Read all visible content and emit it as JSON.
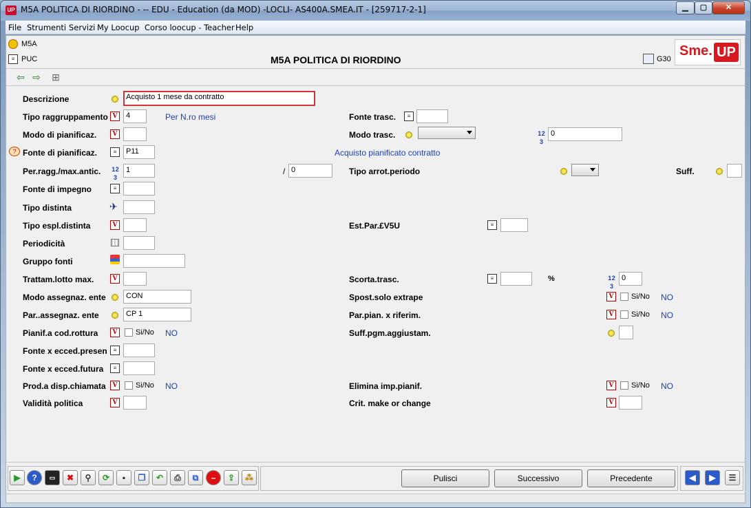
{
  "window": {
    "title": "M5A POLITICA DI RIORDINO -  -- EDU - Education (da MOD) -LOCLI- AS400A.SMEA.IT - [259717-2-1]",
    "app_icon": "UP",
    "controls": {
      "minimize": "▁",
      "maximize": "▢",
      "close": "✕"
    }
  },
  "menu": [
    "File",
    "Strumenti",
    "Servizi",
    "My Loocup",
    "Corso loocup - Teacher",
    "Help"
  ],
  "header": {
    "code1": "M5A",
    "code2": "PUC",
    "title": "M5A POLITICA DI RIORDINO",
    "right_code": "G30",
    "logo_left": "Sme.",
    "logo_right": "UP"
  },
  "fields": {
    "descrizione": {
      "label": "Descrizione",
      "value": "Acquisto 1 mese da contratto"
    },
    "tipo_raggr": {
      "label": "Tipo raggruppamento",
      "value": "4",
      "desc": "Per N.ro mesi"
    },
    "modo_pian": {
      "label": "Modo di pianificaz.",
      "value": ""
    },
    "fonte_pian": {
      "label": "Fonte di pianificaz.",
      "value": "P11",
      "desc": "Acquisto pianificato contratto"
    },
    "per_ragg": {
      "label": "Per.ragg./max.antic.",
      "value": "1",
      "sep": "/",
      "value2": "0"
    },
    "fonte_imp": {
      "label": "Fonte di impegno",
      "value": ""
    },
    "tipo_dist": {
      "label": "Tipo distinta",
      "value": ""
    },
    "tipo_espl": {
      "label": "Tipo espl.distinta",
      "value": ""
    },
    "periodicita": {
      "label": "Periodicità",
      "value": ""
    },
    "gruppo_fonti": {
      "label": "Gruppo fonti",
      "value": ""
    },
    "trattam": {
      "label": "Trattam.lotto max.",
      "value": ""
    },
    "modo_ass": {
      "label": "Modo assegnaz. ente",
      "value": "CON"
    },
    "par_ass": {
      "label": "Par..assegnaz. ente",
      "value": "CP 1"
    },
    "pianif_cod": {
      "label": "Pianif.a cod.rottura",
      "chk": "Si/No",
      "desc": "NO"
    },
    "fonte_pres": {
      "label": "Fonte x ecced.presen",
      "value": ""
    },
    "fonte_fut": {
      "label": "Fonte x ecced.futura",
      "value": ""
    },
    "prod_disp": {
      "label": "Prod.a disp.chiamata",
      "chk": "Si/No",
      "desc": "NO"
    },
    "validita": {
      "label": "Validità politica",
      "value": ""
    },
    "fonte_trasc": {
      "label": "Fonte trasc.",
      "value": ""
    },
    "modo_trasc": {
      "label": "Modo  trasc.",
      "value": "0"
    },
    "tipo_arrot": {
      "label": "Tipo arrot.periodo"
    },
    "suff": {
      "label": "Suff."
    },
    "est_par": {
      "label": "Est.Par.£V5U",
      "value": ""
    },
    "scorta": {
      "label": "Scorta.trasc.",
      "value": "",
      "unit": "%",
      "value2": "0"
    },
    "spost": {
      "label": "Spost.solo extrape",
      "chk": "Si/No",
      "desc": "NO"
    },
    "par_pian": {
      "label": "Par.pian. x riferim.",
      "chk": "Si/No",
      "desc": "NO"
    },
    "suff_pgm": {
      "label": "Suff.pgm.aggiustam.",
      "value": ""
    },
    "elimina": {
      "label": "Elimina imp.pianif.",
      "chk": "Si/No",
      "desc": "NO"
    },
    "crit": {
      "label": "Crit. make or change",
      "value": ""
    }
  },
  "buttons": {
    "pulisci": "Pulisci",
    "successivo": "Successivo",
    "precedente": "Precedente"
  },
  "icons": {
    "v": "V",
    "list": "≡",
    "num": "1 2 3",
    "help_face": "?"
  }
}
